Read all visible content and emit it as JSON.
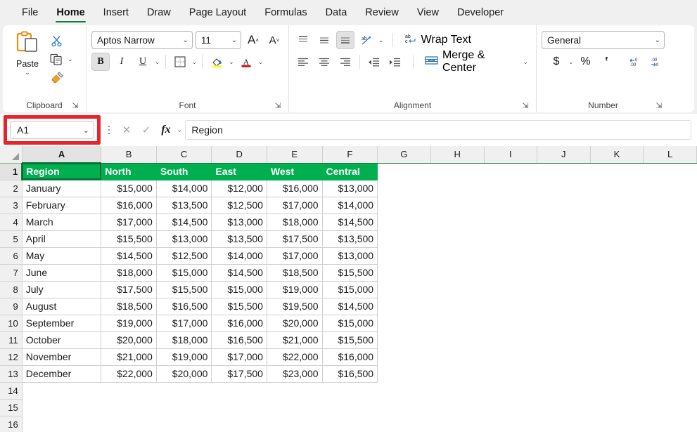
{
  "ribbon": {
    "tabs": [
      {
        "label": "File",
        "active": false
      },
      {
        "label": "Home",
        "active": true
      },
      {
        "label": "Insert",
        "active": false
      },
      {
        "label": "Draw",
        "active": false
      },
      {
        "label": "Page Layout",
        "active": false
      },
      {
        "label": "Formulas",
        "active": false
      },
      {
        "label": "Data",
        "active": false
      },
      {
        "label": "Review",
        "active": false
      },
      {
        "label": "View",
        "active": false
      },
      {
        "label": "Developer",
        "active": false
      }
    ],
    "clipboard": {
      "group_label": "Clipboard",
      "paste_label": "Paste",
      "cut_icon": "scissors-icon",
      "copy_icon": "copy-icon",
      "format_painter_icon": "format-painter-icon"
    },
    "font": {
      "group_label": "Font",
      "font_name": "Aptos Narrow",
      "font_size": "11",
      "grow_font_label": "A",
      "shrink_font_label": "A",
      "bold_label": "B",
      "italic_label": "I",
      "underline_label": "U",
      "borders_icon": "borders-icon",
      "fill_color_label": "A",
      "font_color_label": "A",
      "fill_color": "#ffff00",
      "font_color": "#e00000"
    },
    "alignment": {
      "group_label": "Alignment",
      "wrap_text_label": "Wrap Text",
      "merge_center_label": "Merge & Center",
      "orientation_icon": "text-orientation-icon",
      "decrease_indent_icon": "decrease-indent-icon",
      "increase_indent_icon": "increase-indent-icon"
    },
    "number": {
      "group_label": "Number",
      "format": "General",
      "accounting_label": "$",
      "percent_label": "%",
      "comma_label": "̔",
      "increase_decimal_icon": "increase-decimal-icon",
      "decrease_decimal_icon": "decrease-decimal-icon"
    }
  },
  "formula_bar": {
    "name_box_value": "A1",
    "name_box_placeholder": "Name Box",
    "cancel_icon": "cancel-icon",
    "enter_icon": "check-icon",
    "insert_function_label": "fx",
    "formula_value": "Region",
    "highlight_color": "#e8232a"
  },
  "grid": {
    "columns": [
      "A",
      "B",
      "C",
      "D",
      "E",
      "F",
      "G",
      "H",
      "I",
      "J",
      "K",
      "L"
    ],
    "rows": [
      "1",
      "2",
      "3",
      "4",
      "5",
      "6",
      "7",
      "8",
      "9",
      "10",
      "11",
      "12",
      "13",
      "14",
      "15",
      "16"
    ],
    "selected_cell": "A1",
    "header_fill": "#00b050",
    "header_text_color": "#ffffff",
    "table": {
      "header": [
        "Region",
        "North",
        "South",
        "East",
        "West",
        "Central"
      ],
      "rows": [
        [
          "January",
          "$15,000",
          "$14,000",
          "$12,000",
          "$16,000",
          "$13,000"
        ],
        [
          "February",
          "$16,000",
          "$13,500",
          "$12,500",
          "$17,000",
          "$14,000"
        ],
        [
          "March",
          "$17,000",
          "$14,500",
          "$13,000",
          "$18,000",
          "$14,500"
        ],
        [
          "April",
          "$15,500",
          "$13,000",
          "$13,500",
          "$17,500",
          "$13,500"
        ],
        [
          "May",
          "$14,500",
          "$12,500",
          "$14,000",
          "$17,000",
          "$13,000"
        ],
        [
          "June",
          "$18,000",
          "$15,000",
          "$14,500",
          "$18,500",
          "$15,500"
        ],
        [
          "July",
          "$17,500",
          "$15,500",
          "$15,000",
          "$19,000",
          "$15,000"
        ],
        [
          "August",
          "$18,500",
          "$16,500",
          "$15,500",
          "$19,500",
          "$14,500"
        ],
        [
          "September",
          "$19,000",
          "$17,000",
          "$16,000",
          "$20,000",
          "$15,000"
        ],
        [
          "October",
          "$20,000",
          "$18,000",
          "$16,500",
          "$21,000",
          "$15,500"
        ],
        [
          "November",
          "$21,000",
          "$19,000",
          "$17,000",
          "$22,000",
          "$16,000"
        ],
        [
          "December",
          "$22,000",
          "$20,000",
          "$17,500",
          "$23,000",
          "$16,500"
        ]
      ]
    }
  }
}
